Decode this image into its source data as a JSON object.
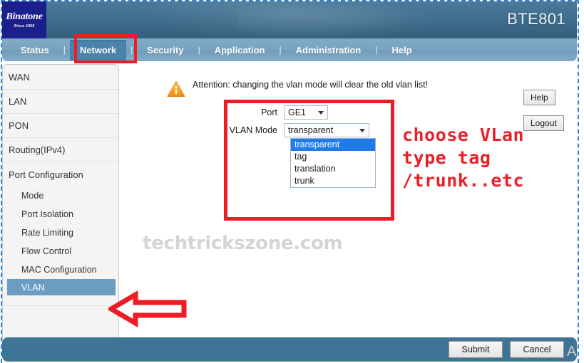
{
  "header": {
    "logo_name": "Binatone",
    "logo_tagline": "Since 1958",
    "model": "BTE801"
  },
  "nav": {
    "items": [
      {
        "label": "Status",
        "active": false
      },
      {
        "label": "Network",
        "active": true
      },
      {
        "label": "Security",
        "active": false
      },
      {
        "label": "Application",
        "active": false
      },
      {
        "label": "Administration",
        "active": false
      },
      {
        "label": "Help",
        "active": false
      }
    ],
    "separator": "|"
  },
  "sidebar": {
    "items": [
      {
        "label": "WAN"
      },
      {
        "label": "LAN"
      },
      {
        "label": "PON"
      },
      {
        "label": "Routing(IPv4)"
      },
      {
        "label": "Port Configuration"
      }
    ],
    "sub_items": [
      {
        "label": "Mode",
        "selected": false
      },
      {
        "label": "Port Isolation",
        "selected": false
      },
      {
        "label": "Rate Limiting",
        "selected": false
      },
      {
        "label": "Flow Control",
        "selected": false
      },
      {
        "label": "MAC Configuration",
        "selected": false
      },
      {
        "label": "VLAN",
        "selected": true
      }
    ]
  },
  "content": {
    "notice": "Attention: changing the vlan mode will clear the old vlan list!",
    "help_label": "Help",
    "logout_label": "Logout",
    "form": {
      "port_label": "Port",
      "port_value": "GE1",
      "vlan_mode_label": "VLAN Mode",
      "vlan_mode_value": "transparent",
      "vlan_mode_options": [
        {
          "label": "transparent",
          "selected": true
        },
        {
          "label": "tag",
          "selected": false
        },
        {
          "label": "translation",
          "selected": false
        },
        {
          "label": "trunk",
          "selected": false
        }
      ]
    },
    "watermark": "techtrickszone.com",
    "corner_mark": "A"
  },
  "annotations": {
    "red_note_line1": "choose VLan",
    "red_note_line2": "type tag",
    "red_note_line3": "/trunk..etc",
    "accent_color": "#ee1c25"
  },
  "footer": {
    "submit_label": "Submit",
    "cancel_label": "Cancel"
  }
}
